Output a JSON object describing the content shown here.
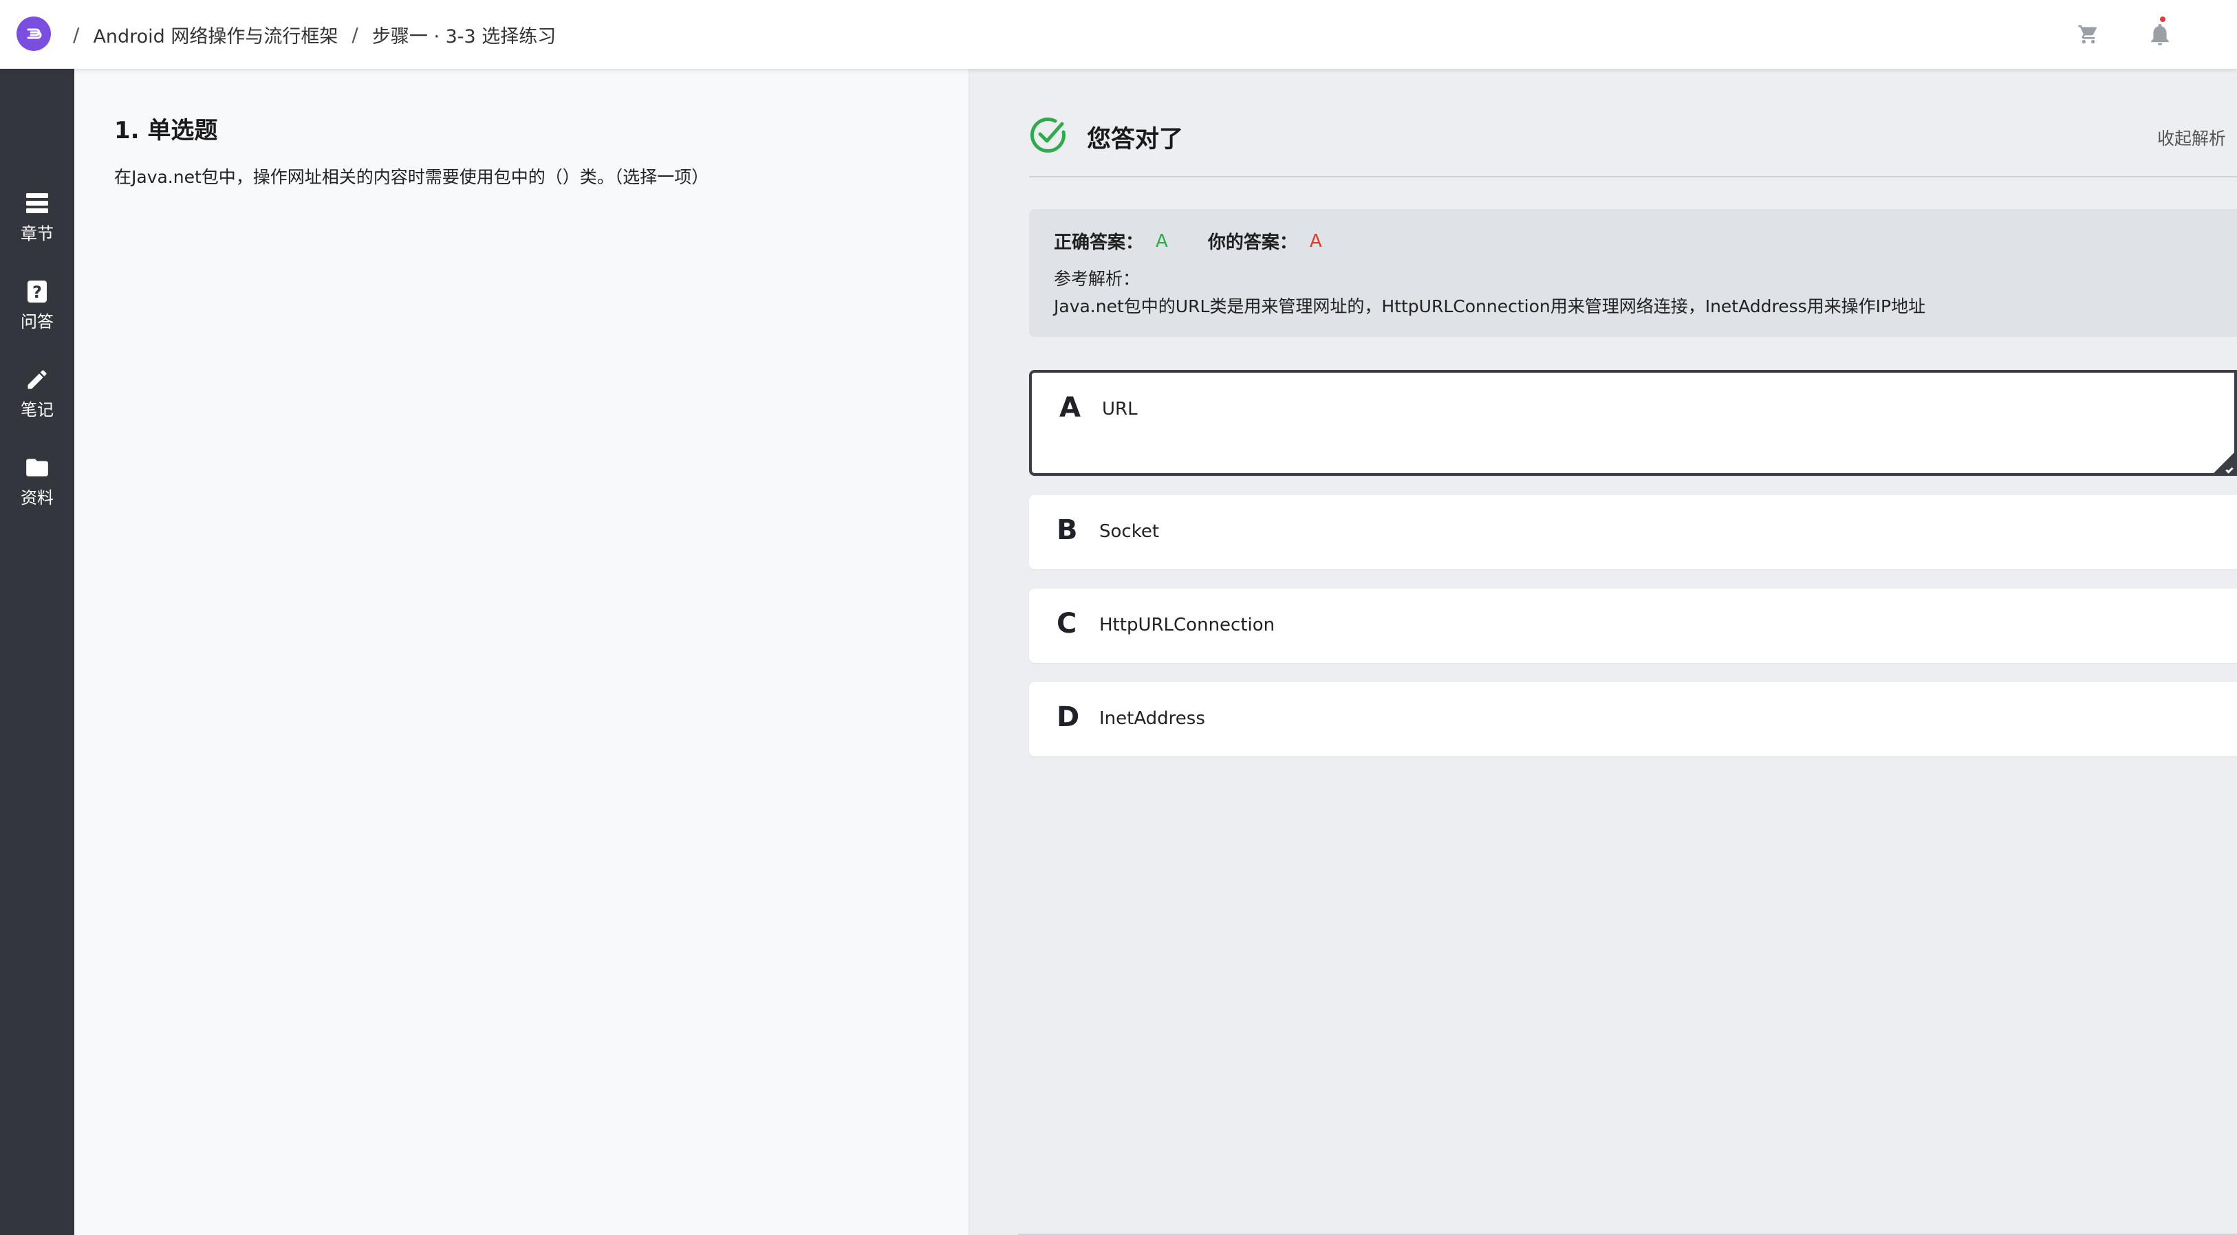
{
  "header": {
    "breadcrumb": [
      "Android 网络操作与流行框架",
      "步骤一 · 3-3 选择练习"
    ],
    "separator": "/",
    "icons": [
      "logo-icon",
      "cart-icon",
      "bell-icon"
    ]
  },
  "sidebar": {
    "items": [
      {
        "label": "章节",
        "icon": "list-icon"
      },
      {
        "label": "问答",
        "icon": "question-icon"
      },
      {
        "label": "笔记",
        "icon": "pencil-icon"
      },
      {
        "label": "资料",
        "icon": "folder-icon"
      }
    ]
  },
  "question": {
    "title": "1. 单选题",
    "text": "在Java.net包中，操作网址相关的内容时需要使用包中的（）类。（选择一项）"
  },
  "result": {
    "title": "您答对了",
    "collapse_label": "收起解析",
    "correct_label": "正确答案：",
    "correct_value": "A",
    "your_label": "你的答案：",
    "your_value": "A",
    "analysis_label": "参考解析：",
    "analysis_text": "Java.net包中的URL类是用来管理网址的，HttpURLConnection用来管理网络连接，InetAddress用来操作IP地址"
  },
  "options": [
    {
      "letter": "A",
      "text": "URL"
    },
    {
      "letter": "B",
      "text": "Socket"
    },
    {
      "letter": "C",
      "text": "HttpURLConnection"
    },
    {
      "letter": "D",
      "text": "InetAddress"
    }
  ],
  "colors": {
    "accent": "#7a4ee0",
    "correct": "#2faa4d",
    "wrong": "#e03a2f",
    "sidebar": "#33373d"
  }
}
